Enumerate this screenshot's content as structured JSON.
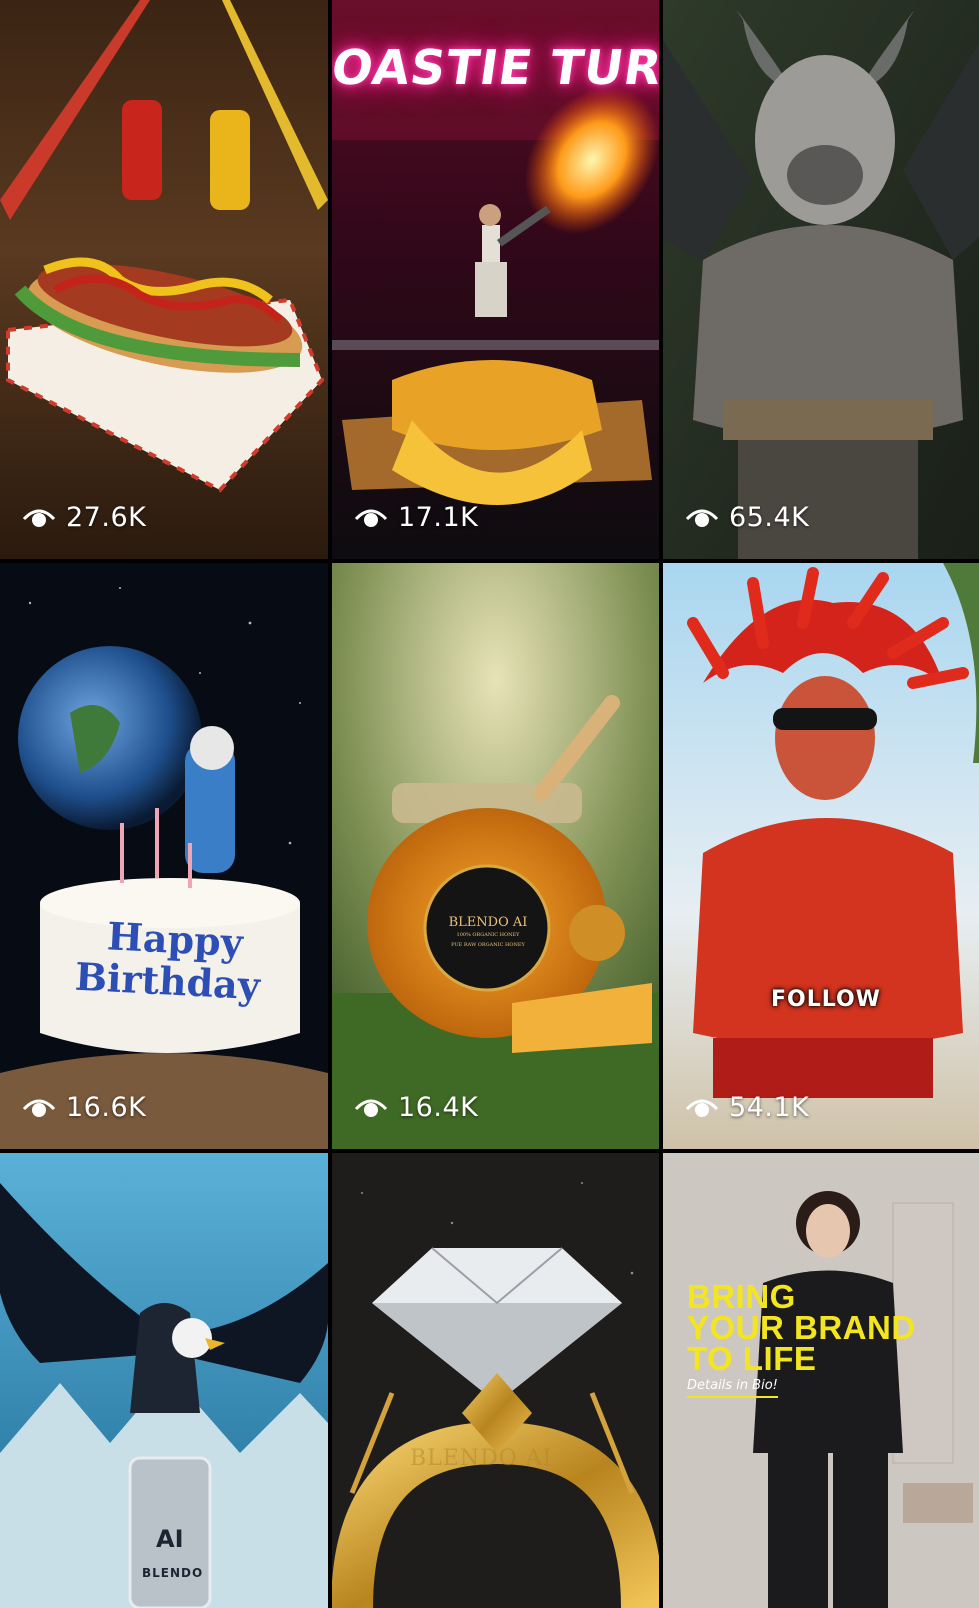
{
  "grid": {
    "tiles": [
      {
        "id": "hotdog",
        "views": "27.6K"
      },
      {
        "id": "toastie",
        "views": "17.1K",
        "sign": "OASTIE TURNDUP"
      },
      {
        "id": "minotaur",
        "views": "65.4K"
      },
      {
        "id": "birthday",
        "views": "16.6K",
        "cake_line1": "Happy",
        "cake_line2": "Birthday"
      },
      {
        "id": "honey",
        "views": "16.4K",
        "jar_brand": "BLENDO AI",
        "jar_sub": "100% ORGANIC HONEY",
        "jar_line": "PUE RAW ORGANIC HONEY"
      },
      {
        "id": "chili",
        "views": "54.1K",
        "overlay": "FOLLOW"
      },
      {
        "id": "eagle",
        "can_label": "BLENDO",
        "can_logo": "AI"
      },
      {
        "id": "ring",
        "engraving": "BLENDO AI"
      },
      {
        "id": "brand",
        "headline_1": "BRING",
        "headline_2": "YOUR BRAND",
        "headline_3": "TO LIFE",
        "subtext": "Details in Bio!"
      }
    ]
  },
  "icons": {
    "views": "eye-icon"
  },
  "colors": {
    "brand_yellow": "#f3e620",
    "view_text": "#ffffff",
    "neon_pink": "#ff3aa8"
  }
}
